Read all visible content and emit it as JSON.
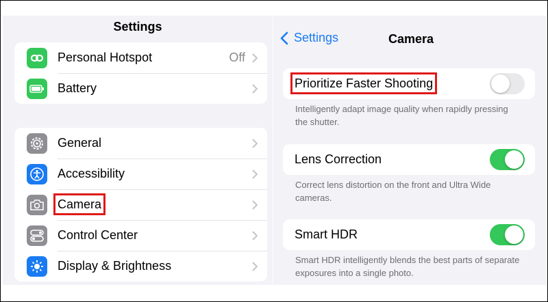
{
  "left": {
    "title": "Settings",
    "group1": [
      {
        "label": "Personal Hotspot",
        "value": "Off",
        "icon": "hotspot-link-icon",
        "color": "#34c759"
      },
      {
        "label": "Battery",
        "icon": "battery-icon",
        "color": "#34c759"
      }
    ],
    "group2": [
      {
        "label": "General",
        "icon": "gear-icon",
        "color": "#8e8e93"
      },
      {
        "label": "Accessibility",
        "icon": "accessibility-icon",
        "color": "#1a7bf2"
      },
      {
        "label": "Camera",
        "icon": "camera-icon",
        "color": "#8e8e93",
        "highlighted": true
      },
      {
        "label": "Control Center",
        "icon": "toggles-icon",
        "color": "#8e8e93"
      },
      {
        "label": "Display & Brightness",
        "icon": "sun-icon",
        "color": "#1a7bf2"
      }
    ]
  },
  "right": {
    "back_label": "Settings",
    "title": "Camera",
    "options": [
      {
        "label": "Prioritize Faster Shooting",
        "on": false,
        "highlighted": true,
        "footer": "Intelligently adapt image quality when rapidly pressing the shutter."
      },
      {
        "label": "Lens Correction",
        "on": true,
        "footer": "Correct lens distortion on the front and Ultra Wide cameras."
      },
      {
        "label": "Smart HDR",
        "on": true,
        "footer": "Smart HDR intelligently blends the best parts of separate exposures into a single photo."
      }
    ]
  },
  "colors": {
    "toggle_on": "#34c759",
    "toggle_off": "#e9e9eb",
    "accent": "#1a7bf2",
    "highlight": "#e01919"
  }
}
